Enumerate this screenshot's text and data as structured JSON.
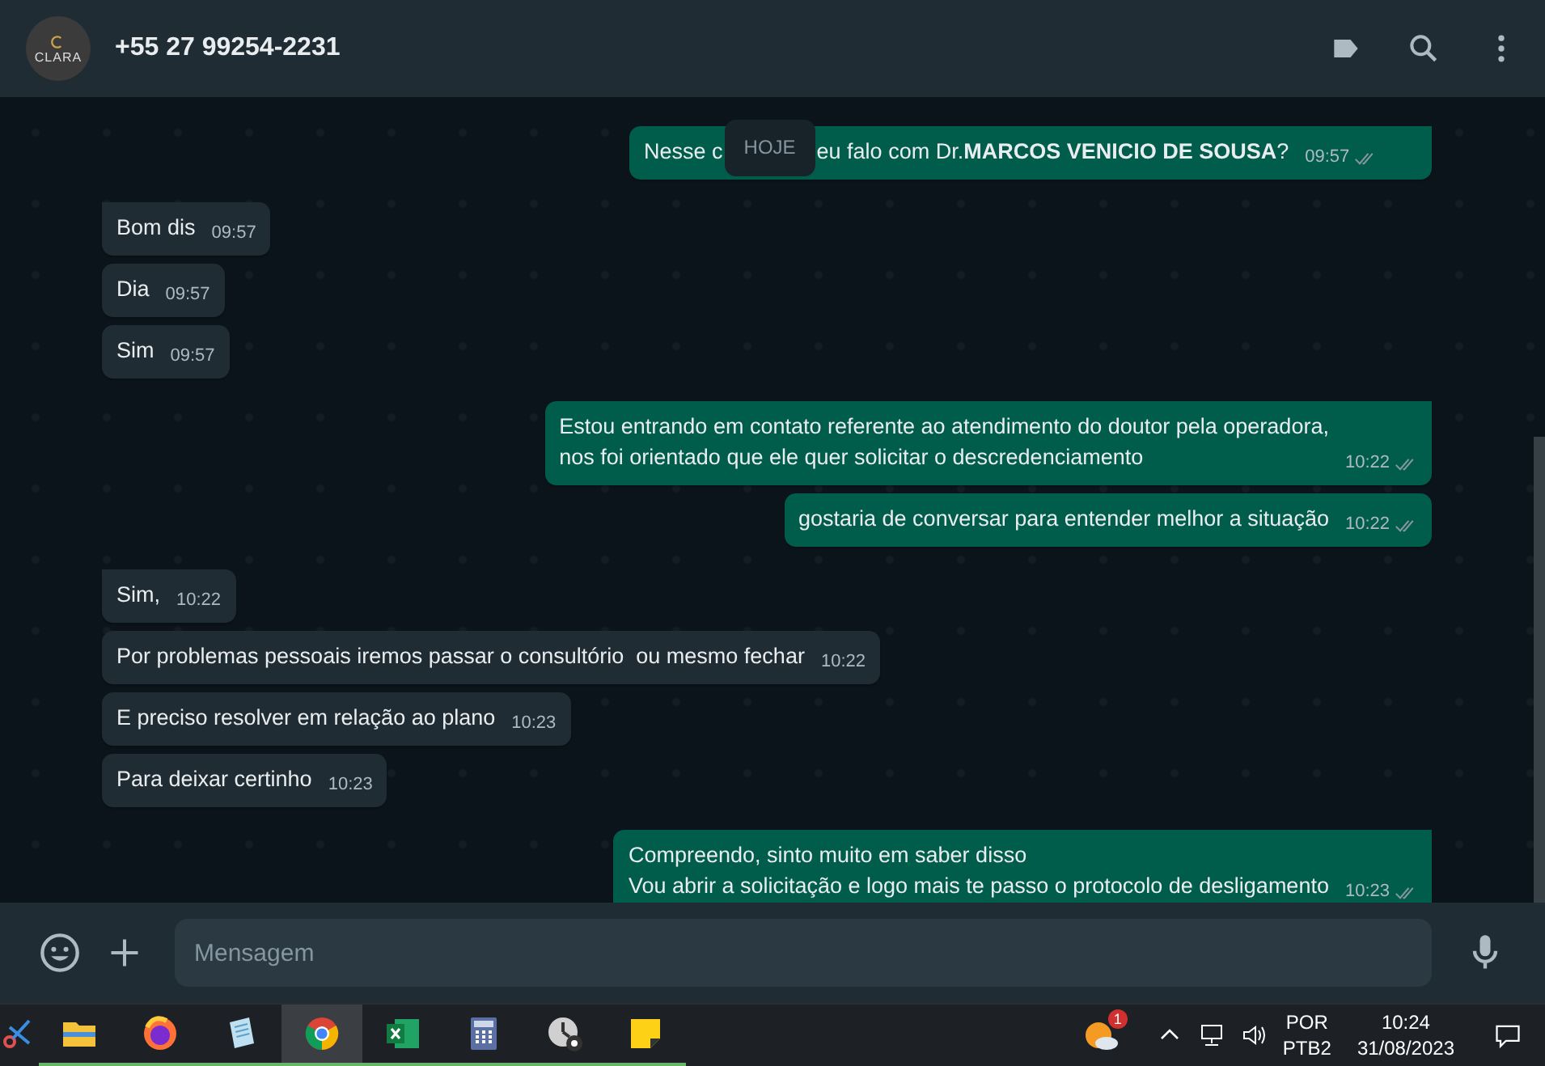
{
  "header": {
    "avatar_label": "CLARA",
    "title": "+55 27 99254-2231"
  },
  "date_chip": "HOJE",
  "groups": [
    {
      "kind": "outgoing",
      "messages": [
        {
          "text_parts": [
            "Nesse c",
            "eu falo com Dr.**MARCOS VENICIO DE SOUSA**?"
          ],
          "time": "09:57"
        }
      ]
    },
    {
      "kind": "incoming",
      "messages": [
        {
          "text_parts": [
            "Bom dis"
          ],
          "time": "09:57"
        },
        {
          "text_parts": [
            "Dia"
          ],
          "time": "09:57"
        },
        {
          "text_parts": [
            "Sim"
          ],
          "time": "09:57"
        }
      ]
    },
    {
      "kind": "outgoing",
      "messages": [
        {
          "text_parts": [
            "Estou entrando em contato referente ao atendimento do doutor pela operadora,\nnos foi orientado que ele quer solicitar o descredenciamento"
          ],
          "time": "10:22"
        },
        {
          "text_parts": [
            "gostaria de conversar para entender melhor a situação"
          ],
          "time": "10:22"
        }
      ]
    },
    {
      "kind": "incoming",
      "messages": [
        {
          "text_parts": [
            "Sim,"
          ],
          "time": "10:22"
        },
        {
          "text_parts": [
            "Por problemas pessoais iremos passar o consultório  ou mesmo fechar"
          ],
          "time": "10:22"
        },
        {
          "text_parts": [
            "E preciso resolver em relação ao plano"
          ],
          "time": "10:23"
        },
        {
          "text_parts": [
            "Para deixar certinho"
          ],
          "time": "10:23"
        }
      ]
    },
    {
      "kind": "outgoing",
      "messages": [
        {
          "text_parts": [
            "Compreendo, sinto muito em saber disso\nVou abrir a solicitação e logo mais te passo o protocolo de desligamento"
          ],
          "time": "10:23"
        }
      ]
    }
  ],
  "composer": {
    "placeholder": "Mensagem"
  },
  "taskbar": {
    "apps": [
      {
        "kind": "snip",
        "selected": false,
        "running": false
      },
      {
        "kind": "folder",
        "selected": false,
        "running": true
      },
      {
        "kind": "firefox",
        "selected": false,
        "running": true
      },
      {
        "kind": "notes",
        "selected": false,
        "running": true
      },
      {
        "kind": "chrome",
        "selected": true,
        "running": true
      },
      {
        "kind": "excel",
        "selected": false,
        "running": true
      },
      {
        "kind": "calculator",
        "selected": false,
        "running": true
      },
      {
        "kind": "clock",
        "selected": false,
        "running": true
      },
      {
        "kind": "sticky",
        "selected": false,
        "running": true
      }
    ],
    "weather_badge": "1",
    "lang": "POR",
    "layout": "PTB2",
    "time": "10:24",
    "date": "31/08/2023"
  }
}
